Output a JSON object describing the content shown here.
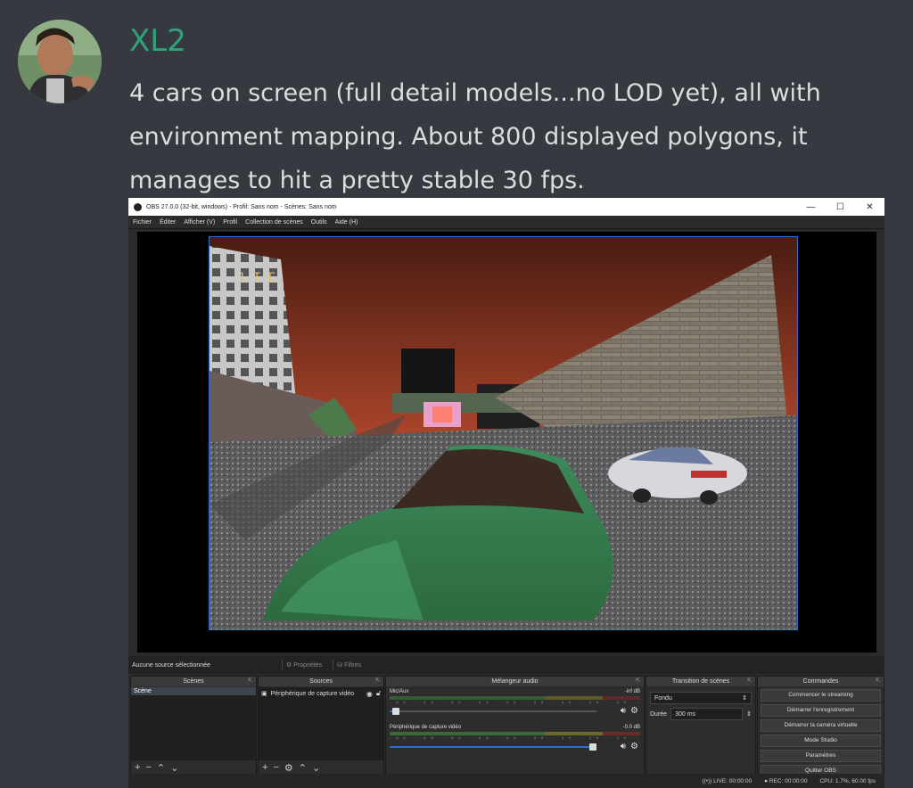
{
  "message": {
    "username": "XL2",
    "username_color": "#2ea37a",
    "text_lines": [
      "4 cars on screen (full detail models...no LOD yet), all with",
      "environment mapping. About 800 displayed polygons, it",
      "manages to hit a pretty stable 30 fps."
    ]
  },
  "obs": {
    "window_title": "OBS 27.0.0 (32-bit, windows) - Profil: Sans nom - Scènes: Sans nom",
    "window_controls": [
      "—",
      "☐",
      "✕"
    ],
    "menu": [
      "Fichier",
      "Éditer",
      "Afficher (V)",
      "Profil",
      "Collection de scènes",
      "Outils",
      "Aide (H)"
    ],
    "preview_hud": "1  T  E",
    "status": {
      "no_selection": "Aucune source sélectionnée",
      "properties": "Propriétés",
      "filters": "Filtres"
    },
    "docks": {
      "scenes": {
        "title": "Scènes",
        "items": [
          "Scène"
        ]
      },
      "sources": {
        "title": "Sources",
        "items": [
          "Périphérique de capture vidéo"
        ]
      },
      "mixer": {
        "title": "Mélangeur audio",
        "channels": [
          {
            "name": "Mic/Aux",
            "level": "-inf dB",
            "volume": 0.03
          },
          {
            "name": "Périphérique de capture vidéo",
            "level": "-0.0 dB",
            "volume": 1.0
          }
        ],
        "ticks": "-60 -55 -50 -45 -40 -35 -30 -25 -20 -15 -10 -5 0"
      },
      "transitions": {
        "title": "Transition de scènes",
        "transition": "Fondu",
        "duration_label": "Durée",
        "duration_value": "300 ms"
      },
      "controls": {
        "title": "Commandes",
        "buttons": [
          "Commencer le streaming",
          "Démarrer l'enregistrement",
          "Démarrer la caméra virtuelle",
          "Mode Studio",
          "Paramètres",
          "Quitter OBS"
        ]
      }
    },
    "bottom_status": {
      "live": "LIVE: 00:00:00",
      "rec": "REC: 00:00:00",
      "cpu": "CPU: 1.7%, 60.00 fps"
    },
    "accent": "#2c6ed3"
  }
}
